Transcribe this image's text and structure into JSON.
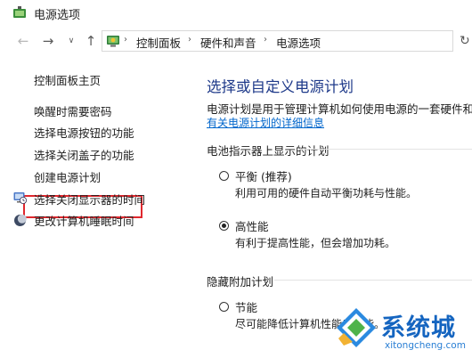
{
  "window": {
    "title": "电源选项"
  },
  "nav": {
    "back": "←",
    "forward": "→",
    "dropdown": "∨",
    "up": "↑",
    "refresh": "↻",
    "breadcrumbs": [
      "控制面板",
      "硬件和声音",
      "电源选项"
    ]
  },
  "sidebar": {
    "home": "控制面板主页",
    "items": [
      {
        "label": "唤醒时需要密码",
        "icon": ""
      },
      {
        "label": "选择电源按钮的功能",
        "icon": ""
      },
      {
        "label": "选择关闭盖子的功能",
        "icon": "",
        "highlighted": true
      },
      {
        "label": "创建电源计划",
        "icon": ""
      },
      {
        "label": "选择关闭显示器的时间",
        "icon": "display-clock-icon"
      },
      {
        "label": "更改计算机睡眠时间",
        "icon": "moon-icon"
      }
    ]
  },
  "main": {
    "title": "选择或自定义电源计划",
    "description": "电源计划是用于管理计算机如何使用电源的一套硬件和系",
    "learn_more": "有关电源计划的详细信息",
    "battery_section": "电池指示器上显示的计划",
    "hidden_section": "隐藏附加计划",
    "plans": [
      {
        "name": "平衡 (推荐)",
        "description": "利用可用的硬件自动平衡功耗与性能。",
        "selected": false
      },
      {
        "name": "高性能",
        "description": "有利于提高性能，但会增加功耗。",
        "selected": true
      },
      {
        "name": "节能",
        "description": "尽可能降低计算机性能以节能。",
        "selected": false
      }
    ]
  },
  "watermark": {
    "text": "系统城",
    "url": "xitongcheng.com"
  },
  "colors": {
    "title_blue": "#1f3a8a",
    "link_blue": "#0066cc",
    "highlight_red": "#e0282e"
  }
}
